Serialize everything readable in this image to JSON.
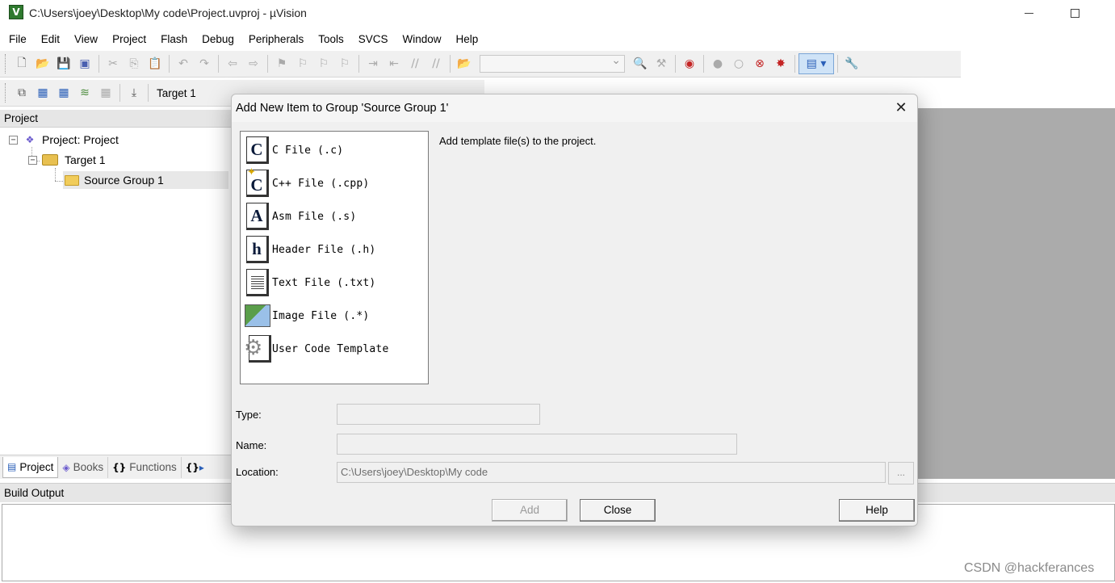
{
  "window": {
    "title": "C:\\Users\\joey\\Desktop\\My code\\Project.uvproj - µVision",
    "app_icon": "keil-uvision-icon"
  },
  "menu": [
    {
      "label": "File"
    },
    {
      "label": "Edit"
    },
    {
      "label": "View"
    },
    {
      "label": "Project"
    },
    {
      "label": "Flash"
    },
    {
      "label": "Debug"
    },
    {
      "label": "Peripherals"
    },
    {
      "label": "Tools"
    },
    {
      "label": "SVCS"
    },
    {
      "label": "Window"
    },
    {
      "label": "Help"
    }
  ],
  "toolbar2": {
    "target_name": "Target 1"
  },
  "project_panel": {
    "header": "Project",
    "tree": {
      "root": "Project: Project",
      "target": "Target 1",
      "group": "Source Group 1"
    },
    "tabs": [
      {
        "label": "Project",
        "icon": "project-tab-icon"
      },
      {
        "label": "Books",
        "icon": "books-icon"
      },
      {
        "label": "Functions",
        "icon": "braces-icon"
      },
      {
        "label": "",
        "icon": "templates-icon"
      }
    ]
  },
  "build_output": {
    "header": "Build Output"
  },
  "dialog": {
    "title": "Add New Item to Group 'Source Group 1'",
    "description": "Add template file(s) to the project.",
    "items": [
      {
        "label": "C File (.c)",
        "icon_letter": "C",
        "icon": "c-file-icon"
      },
      {
        "label": "C++ File (.cpp)",
        "icon_letter": "C",
        "icon": "cpp-file-icon"
      },
      {
        "label": "Asm File (.s)",
        "icon_letter": "A",
        "icon": "asm-file-icon"
      },
      {
        "label": "Header File (.h)",
        "icon_letter": "h",
        "icon": "header-file-icon"
      },
      {
        "label": "Text File (.txt)",
        "icon": "text-file-icon"
      },
      {
        "label": "Image File (.*)",
        "icon": "image-file-icon"
      },
      {
        "label": "User Code Template",
        "icon": "user-template-icon"
      }
    ],
    "fields": {
      "type_label": "Type:",
      "type_value": "",
      "name_label": "Name:",
      "name_value": "",
      "location_label": "Location:",
      "location_value": "C:\\Users\\joey\\Desktop\\My code",
      "browse_label": "..."
    },
    "buttons": {
      "add": "Add",
      "close": "Close",
      "help": "Help"
    }
  },
  "watermark": "CSDN @hackferances"
}
